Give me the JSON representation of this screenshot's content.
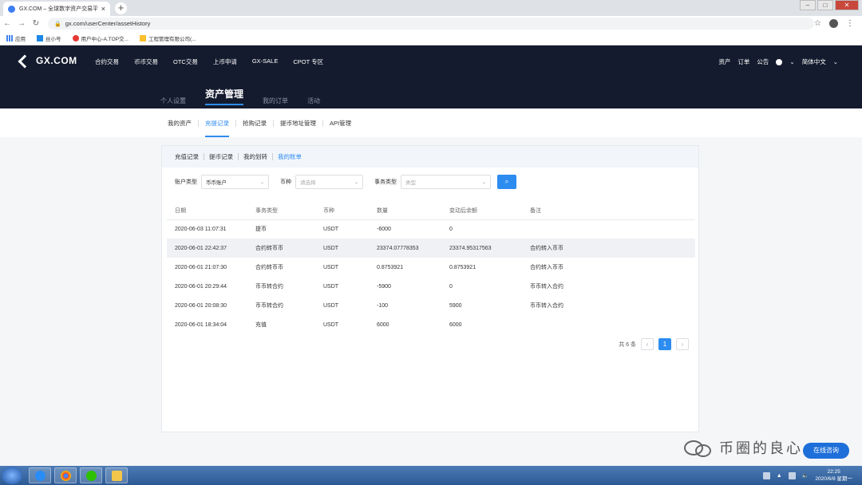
{
  "browser": {
    "tab_title": "GX.COM – 全球数字资产交易平台",
    "url": "gx.com/userCenter/assetHistory",
    "bookmarks": [
      "应用",
      "丝小号",
      "用户中心-A.TOP交...",
      "工程管理有限公司(..."
    ]
  },
  "header": {
    "logo": "GX.COM",
    "nav": [
      "合约交易",
      "币币交易",
      "OTC交易",
      "上币申请",
      "GX-SALE",
      "CPOT 专区"
    ],
    "right_nav": [
      "资产",
      "订单",
      "公告"
    ],
    "language": "简体中文",
    "subnav": [
      {
        "label": "个人设置",
        "active": false
      },
      {
        "label": "资产管理",
        "active": true
      },
      {
        "label": "我的订单",
        "active": false
      },
      {
        "label": "活动",
        "active": false
      }
    ]
  },
  "subtabs": [
    {
      "label": "我的资产",
      "active": false
    },
    {
      "label": "充提记录",
      "active": true
    },
    {
      "label": "抢购记录",
      "active": false
    },
    {
      "label": "提币地址管理",
      "active": false
    },
    {
      "label": "API管理",
      "active": false
    }
  ],
  "panel": {
    "tabs": [
      {
        "label": "充值记录",
        "active": false
      },
      {
        "label": "提币记录",
        "active": false
      },
      {
        "label": "我的划转",
        "active": false
      },
      {
        "label": "我的账单",
        "active": true
      }
    ],
    "filters": {
      "account_label": "账户类型",
      "account_value": "币币账户",
      "coin_label": "币种",
      "coin_placeholder": "请选择",
      "type_label": "事务类型",
      "type_placeholder": "类型"
    },
    "table": {
      "headers": [
        "日期",
        "事务类型",
        "币种",
        "数量",
        "变动后余额",
        "备注"
      ],
      "rows": [
        [
          "2020-06-03 11:07:31",
          "提币",
          "USDT",
          "-6000",
          "0",
          ""
        ],
        [
          "2020-06-01 22:42:37",
          "合约转币币",
          "USDT",
          "23374.07778353",
          "23374.95317563",
          "合约转入币币"
        ],
        [
          "2020-06-01 21:07:30",
          "合约转币币",
          "USDT",
          "0.8753921",
          "0.8753921",
          "合约转入币币"
        ],
        [
          "2020-06-01 20:29:44",
          "币币转合约",
          "USDT",
          "-5900",
          "0",
          "币币转入合约"
        ],
        [
          "2020-06-01 20:08:30",
          "币币转合约",
          "USDT",
          "-100",
          "5900",
          "币币转入合约"
        ],
        [
          "2020-06-01 18:34:04",
          "充值",
          "USDT",
          "6000",
          "6000",
          ""
        ]
      ]
    },
    "pagination": {
      "total": "共 6 条",
      "current": "1"
    }
  },
  "watermark": "币圈的良心",
  "float_button": "在线咨询",
  "taskbar": {
    "time": "22:25",
    "date": "2020/6/8 星期一"
  }
}
